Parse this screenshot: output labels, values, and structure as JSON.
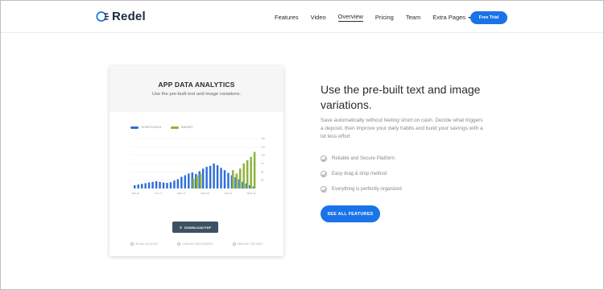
{
  "header": {
    "brand": "Redel",
    "nav": [
      {
        "label": "Features",
        "active": false
      },
      {
        "label": "Video",
        "active": false
      },
      {
        "label": "Overview",
        "active": true
      },
      {
        "label": "Pricing",
        "active": false
      },
      {
        "label": "Team",
        "active": false
      },
      {
        "label": "Extra Pages",
        "active": false,
        "dropdown": true
      }
    ],
    "cta": "Free Trial"
  },
  "card": {
    "title": "APP DATA ANALYTICS",
    "subtitle": "Use the pre-built text and image variations.",
    "download_label": "DOWNLOAD PDF",
    "footer": [
      "INITIAL ACCOUNT",
      "CHANGE DATA SOURCE",
      "ARCHIVE THE DATA"
    ]
  },
  "chart_data": {
    "type": "bar",
    "legend": [
      "TICKETS SOLD",
      "BUDGET"
    ],
    "y_ticks": [
      "150",
      "125",
      "100",
      "75",
      "50",
      "25"
    ],
    "x_ticks": [
      "JAN 16",
      "JUL 17",
      "DEC 17",
      "MAR 18",
      "JAN 19",
      "MAR 19"
    ],
    "ylim": [
      0,
      150
    ],
    "series": [
      {
        "name": "TICKETS SOLD",
        "color": "#2f6fd8",
        "values": [
          10,
          12,
          14,
          16,
          18,
          20,
          22,
          20,
          18,
          17,
          19,
          24,
          28,
          35,
          40,
          45,
          48,
          44,
          52,
          60,
          65,
          68,
          75,
          70,
          62,
          55,
          47,
          40,
          34,
          28,
          20,
          15,
          10,
          6
        ]
      },
      {
        "name": "BUDGET",
        "color": "#8bb33b",
        "values": [
          0,
          0,
          0,
          0,
          0,
          0,
          0,
          0,
          0,
          0,
          0,
          0,
          0,
          0,
          0,
          0,
          30,
          40,
          45,
          0,
          0,
          0,
          0,
          0,
          0,
          0,
          0,
          55,
          45,
          60,
          75,
          85,
          95,
          110
        ]
      }
    ]
  },
  "content": {
    "headline": "Use the pre-built text and image variations.",
    "paragraph": "Save automatically without feeling short on cash. Decide what triggers a deposit, then improve your daily habits and build your savings with a lot less effort",
    "features": [
      "Reliable and Secure Platform",
      "Easy drag & drop method",
      "Everything is perfectly organized"
    ],
    "cta": "SEE ALL FEATURES"
  },
  "colors": {
    "accent": "#1a73e8",
    "dark": "#3d5064",
    "green": "#8bb33b",
    "blue": "#2f6fd8"
  }
}
